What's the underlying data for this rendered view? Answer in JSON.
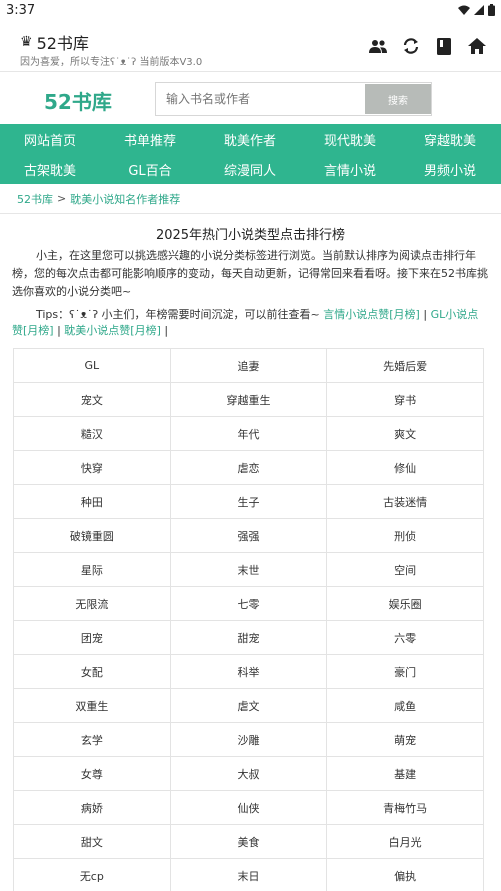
{
  "status_bar": {
    "time": "3:37"
  },
  "app_bar": {
    "title": "52书库",
    "subtitle": "因为喜爱，所以专注ʕ˙ᴥ˙ʔ 当前版本V3.0",
    "actions": [
      "people-icon",
      "sync-icon",
      "book-icon",
      "home-icon"
    ]
  },
  "search": {
    "logo": "52书库",
    "placeholder": "输入书名或作者",
    "button": "搜索"
  },
  "nav": {
    "items": [
      "网站首页",
      "书单推荐",
      "耽美作者",
      "现代耽美",
      "穿越耽美",
      "古架耽美",
      "GL百合",
      "综漫同人",
      "言情小说",
      "男频小说"
    ]
  },
  "breadcrumb": {
    "home": "52书库",
    "separator": ">",
    "current": "耽美小说知名作者推荐"
  },
  "main": {
    "title": "2025年热门小说类型点击排行榜",
    "intro": "小主，在这里您可以挑选感兴趣的小说分类标签进行浏览。当前默认排序为阅读点击排行年榜，您的每次点击都可能影响顺序的变动，每天自动更新，记得常回来看看呀。接下来在52书库挑选你喜欢的小说分类吧~",
    "tips_prefix": "Tips：ʕ˙ᴥ˙ʔ 小主们，年榜需要时间沉淀，可以前往查看~ ",
    "tips_links": [
      "言情小说点赞[月榜]",
      "GL小说点赞[月榜]",
      "耽美小说点赞[月榜]"
    ],
    "tips_sep": " | "
  },
  "tags": [
    [
      "GL",
      "追妻",
      "先婚后爱"
    ],
    [
      "宠文",
      "穿越重生",
      "穿书"
    ],
    [
      "糙汉",
      "年代",
      "爽文"
    ],
    [
      "快穿",
      "虐恋",
      "修仙"
    ],
    [
      "种田",
      "生子",
      "古装迷情"
    ],
    [
      "破镜重圆",
      "强强",
      "刑侦"
    ],
    [
      "星际",
      "末世",
      "空间"
    ],
    [
      "无限流",
      "七零",
      "娱乐圈"
    ],
    [
      "团宠",
      "甜宠",
      "六零"
    ],
    [
      "女配",
      "科举",
      "豪门"
    ],
    [
      "双重生",
      "虐文",
      "咸鱼"
    ],
    [
      "玄学",
      "沙雕",
      "萌宠"
    ],
    [
      "女尊",
      "大叔",
      "基建"
    ],
    [
      "病娇",
      "仙侠",
      "青梅竹马"
    ],
    [
      "甜文",
      "美食",
      "白月光"
    ],
    [
      "无cp",
      "末日",
      "偏执"
    ]
  ],
  "colors": {
    "accent": "#2fb58f",
    "link": "#2fa88a",
    "search_button": "#b7bbb8"
  }
}
